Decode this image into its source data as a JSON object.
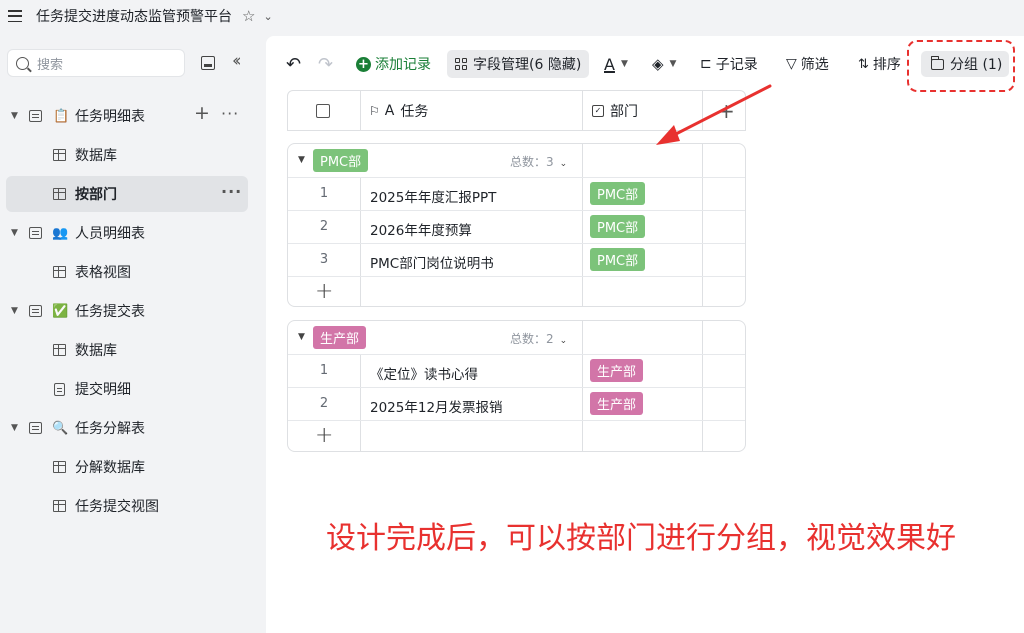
{
  "titlebar": {
    "title": "任务提交进度动态监管预警平台"
  },
  "sidebar": {
    "search_placeholder": "搜索",
    "items": [
      {
        "label": "任务明细表",
        "emoji": "📋"
      },
      {
        "label": "数据库"
      },
      {
        "label": "按部门"
      },
      {
        "label": "人员明细表",
        "emoji": "👥"
      },
      {
        "label": "表格视图"
      },
      {
        "label": "任务提交表",
        "emoji": "✅"
      },
      {
        "label": "数据库"
      },
      {
        "label": "提交明细"
      },
      {
        "label": "任务分解表",
        "emoji": "🔍"
      },
      {
        "label": "分解数据库"
      },
      {
        "label": "任务提交视图"
      }
    ]
  },
  "toolbar": {
    "add_record": "添加记录",
    "field_manage": "字段管理(6 隐藏)",
    "font_color": "A",
    "sub_record": "子记录",
    "filter": "筛选",
    "sort": "排序",
    "group": "分组 (1)"
  },
  "table": {
    "col_task": "任务",
    "col_dept": "部门",
    "groups": [
      {
        "name": "PMC部",
        "count_label": "总数：3",
        "rows": [
          {
            "idx": "1",
            "task": "2025年年度汇报PPT",
            "dept": "PMC部"
          },
          {
            "idx": "2",
            "task": "2026年年度预算",
            "dept": "PMC部"
          },
          {
            "idx": "3",
            "task": "PMC部门岗位说明书",
            "dept": "PMC部"
          }
        ]
      },
      {
        "name": "生产部",
        "count_label": "总数：2",
        "rows": [
          {
            "idx": "1",
            "task": "《定位》读书心得",
            "dept": "生产部"
          },
          {
            "idx": "2",
            "task": "2025年12月发票报销",
            "dept": "生产部"
          }
        ]
      }
    ]
  },
  "caption": "设计完成后，可以按部门进行分组，视觉效果好",
  "colors": {
    "accent_red": "#e8312f",
    "tag_green": "#7cc37a",
    "tag_pink": "#d275a8",
    "brand_green": "#1a7f37"
  }
}
